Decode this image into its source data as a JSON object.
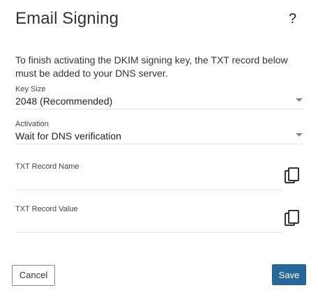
{
  "dialog": {
    "title": "Email Signing",
    "help_label": "?",
    "description": "To finish activating the DKIM signing key, the TXT record below must be added to your DNS server."
  },
  "key_size": {
    "label": "Key Size",
    "value": "2048 (Recommended)"
  },
  "activation": {
    "label": "Activation",
    "value": "Wait for DNS verification"
  },
  "txt_record_name": {
    "label": "TXT Record Name",
    "value": "",
    "copy_icon": "copy-icon"
  },
  "txt_record_value": {
    "label": "TXT Record Value",
    "value": "",
    "copy_icon": "copy-icon"
  },
  "footer": {
    "cancel_label": "Cancel",
    "save_label": "Save"
  },
  "colors": {
    "primary": "#27679a",
    "border": "#e3e3e3"
  }
}
